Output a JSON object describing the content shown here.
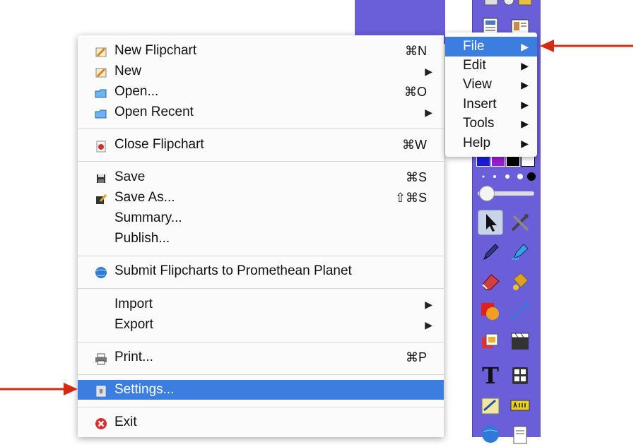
{
  "menubar": {
    "items": [
      {
        "label": "File",
        "submenu": "▶"
      },
      {
        "label": "Edit",
        "submenu": "▶"
      },
      {
        "label": "View",
        "submenu": "▶"
      },
      {
        "label": "Insert",
        "submenu": "▶"
      },
      {
        "label": "Tools",
        "submenu": "▶"
      },
      {
        "label": "Help",
        "submenu": "▶"
      }
    ]
  },
  "file_menu": {
    "items": [
      {
        "label": "New Flipchart",
        "shortcut": "⌘N",
        "icon": "flipchart-icon"
      },
      {
        "label": "New",
        "submenu": "▶",
        "icon": "flipchart-icon"
      },
      {
        "label": "Open...",
        "shortcut": "⌘O",
        "icon": "folder-icon"
      },
      {
        "label": "Open Recent",
        "submenu": "▶",
        "icon": "folder-icon"
      },
      {
        "label": "Close Flipchart",
        "shortcut": "⌘W",
        "icon": "close-doc-icon"
      },
      {
        "label": "Save",
        "shortcut": "⌘S",
        "icon": "floppy-icon"
      },
      {
        "label": "Save As...",
        "shortcut": "⇧⌘S",
        "icon": "save-as-icon"
      },
      {
        "label": "Summary..."
      },
      {
        "label": "Publish..."
      },
      {
        "label": "Submit Flipcharts to Promethean Planet",
        "icon": "globe-icon"
      },
      {
        "label": "Import",
        "submenu": "▶"
      },
      {
        "label": "Export",
        "submenu": "▶"
      },
      {
        "label": "Print...",
        "shortcut": "⌘P",
        "icon": "printer-icon"
      },
      {
        "label": "Settings...",
        "icon": "settings-icon"
      },
      {
        "label": "Exit",
        "icon": "exit-icon"
      }
    ]
  },
  "toolbar": {
    "text_tool_glyph": "T"
  },
  "colors": {
    "highlight": "#3c7de0",
    "toolbar_bg": "#6a5ed9",
    "arrow": "#d42a12"
  }
}
